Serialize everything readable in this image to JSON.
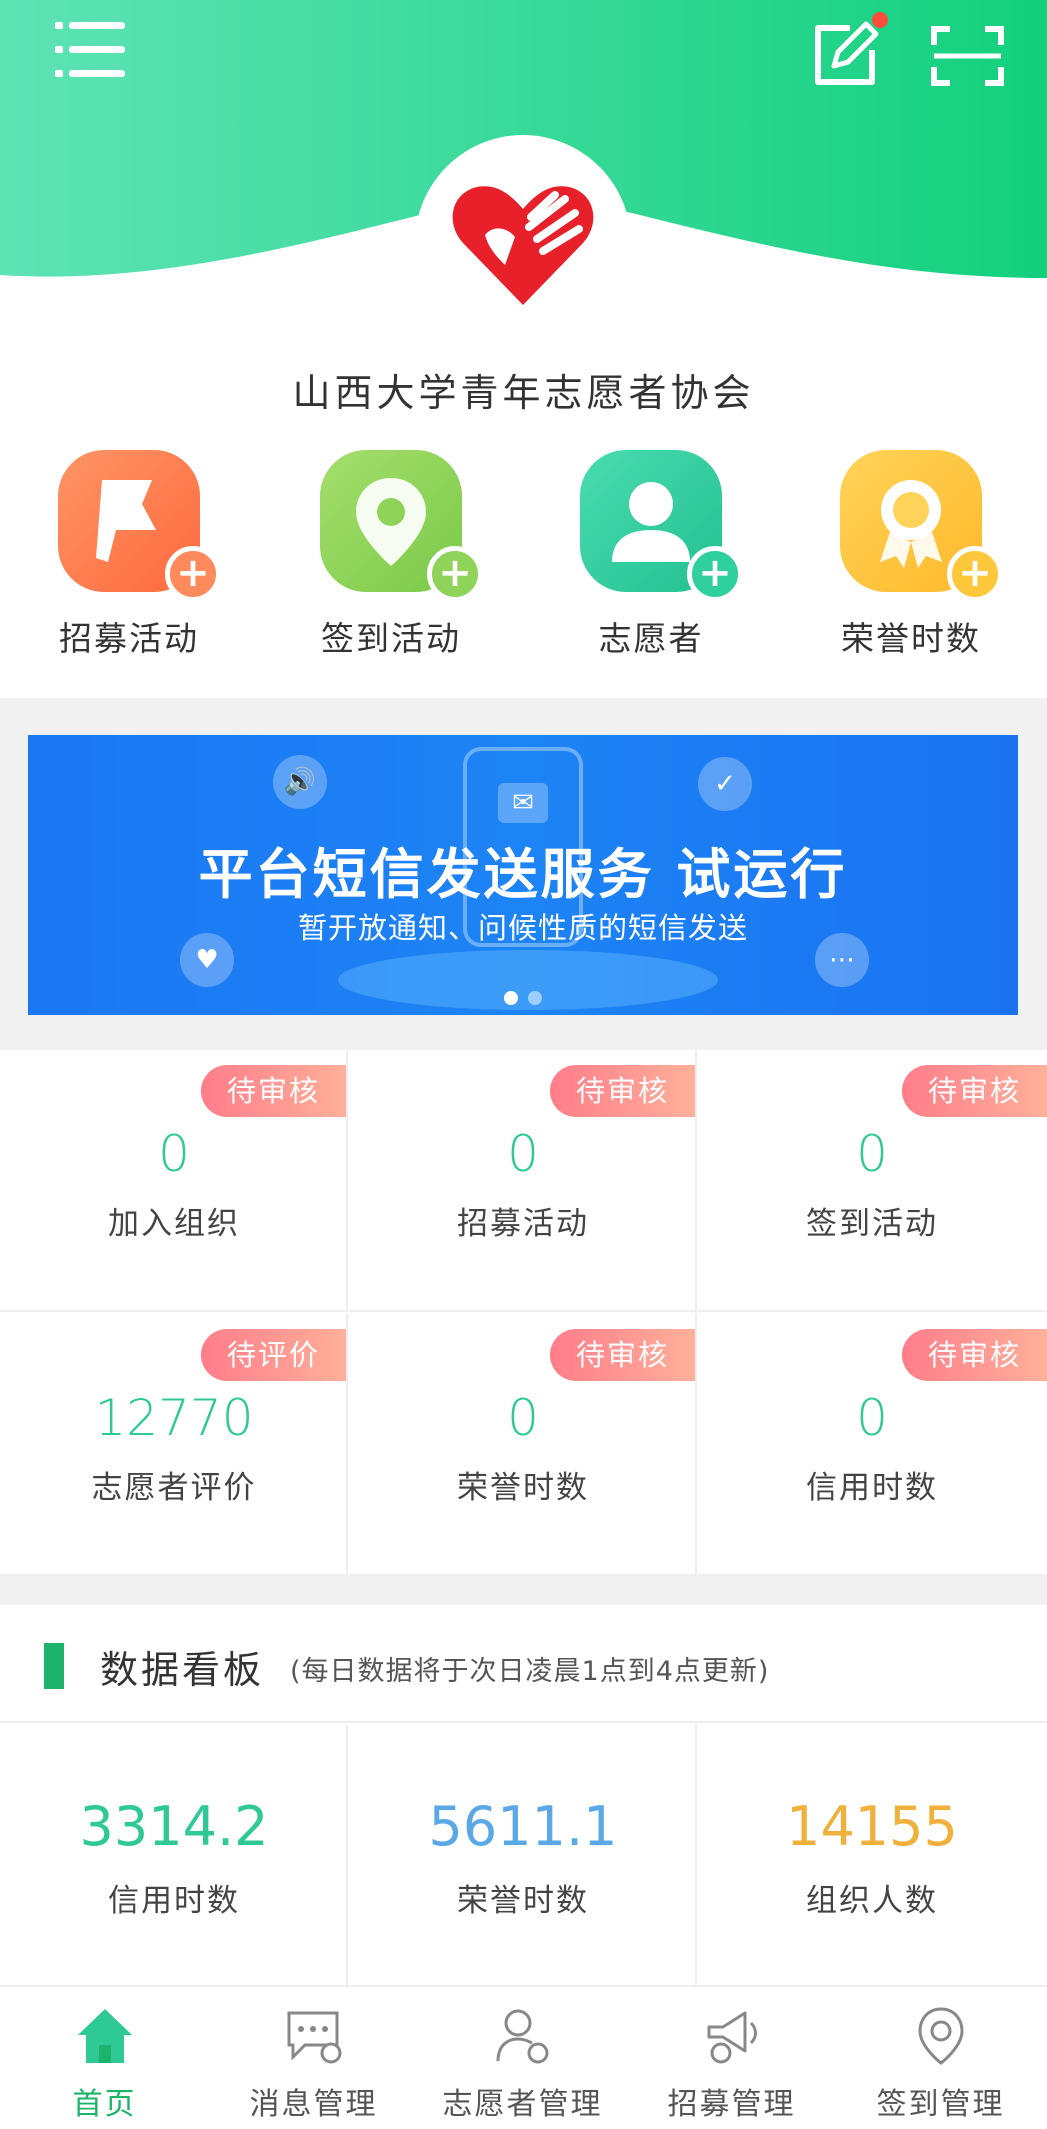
{
  "header": {
    "org_name": "山西大学青年志愿者协会",
    "gradient_start": "#5ee3b5",
    "gradient_end": "#13d07d"
  },
  "quick_actions": [
    {
      "label": "招募活动",
      "color": "#ff7a4a",
      "icon": "flag-icon"
    },
    {
      "label": "签到活动",
      "color": "#8fd35a",
      "icon": "location-pin-icon"
    },
    {
      "label": "志愿者",
      "color": "#2fcf9e",
      "icon": "person-icon"
    },
    {
      "label": "荣誉时数",
      "color": "#ffc83c",
      "icon": "medal-icon"
    }
  ],
  "banner": {
    "title": "平台短信发送服务 试运行",
    "subtitle": "暂开放通知、问候性质的短信发送",
    "active_slide": 1,
    "slide_count": 2
  },
  "stats": [
    {
      "badge": "待审核",
      "value": "0",
      "label": "加入组织"
    },
    {
      "badge": "待审核",
      "value": "0",
      "label": "招募活动"
    },
    {
      "badge": "待审核",
      "value": "0",
      "label": "签到活动"
    },
    {
      "badge": "待评价",
      "value": "12770",
      "label": "志愿者评价"
    },
    {
      "badge": "待审核",
      "value": "0",
      "label": "荣誉时数"
    },
    {
      "badge": "待审核",
      "value": "0",
      "label": "信用时数"
    }
  ],
  "board": {
    "title": "数据看板",
    "note": "(每日数据将于次日凌晨1点到4点更新)",
    "items": [
      {
        "value": "3314.2",
        "label": "信用时数",
        "color": "#2ec995"
      },
      {
        "value": "5611.1",
        "label": "荣誉时数",
        "color": "#5aa9e6"
      },
      {
        "value": "14155",
        "label": "组织人数",
        "color": "#f0b03c"
      }
    ]
  },
  "nav": [
    {
      "label": "首页",
      "icon": "home-icon",
      "active": true
    },
    {
      "label": "消息管理",
      "icon": "message-settings-icon",
      "active": false
    },
    {
      "label": "志愿者管理",
      "icon": "volunteer-settings-icon",
      "active": false
    },
    {
      "label": "招募管理",
      "icon": "megaphone-settings-icon",
      "active": false
    },
    {
      "label": "签到管理",
      "icon": "checkin-settings-icon",
      "active": false
    }
  ]
}
